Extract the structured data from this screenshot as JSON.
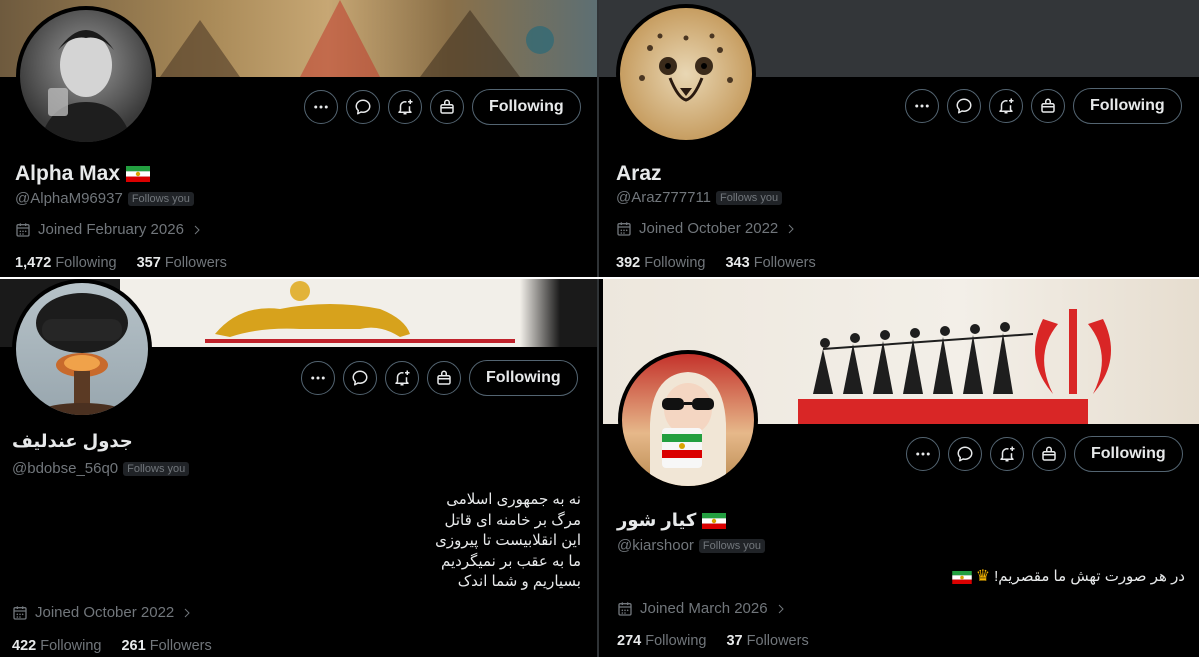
{
  "profiles": [
    {
      "name": "Alpha Max",
      "handle": "@AlphaM96937",
      "follows_you": "Follows you",
      "joined": "Joined February 2026",
      "following_count": "1,472",
      "following_label": "Following",
      "followers_count": "357",
      "followers_label": "Followers",
      "follow_button": "Following"
    },
    {
      "name": "Araz",
      "handle": "@Araz777711",
      "follows_you": "Follows you",
      "joined": "Joined October 2022",
      "following_count": "392",
      "following_label": "Following",
      "followers_count": "343",
      "followers_label": "Followers",
      "follow_button": "Following"
    },
    {
      "name": "جدول عندلیف",
      "handle": "@bdobse_56q0",
      "follows_you": "Follows you",
      "bio": "نه به جمهوری اسلامی\nمرگ بر خامنه ای قاتل\nاین انقلابیست تا پیروزی\nما به عقب بر نمیگردیم\nبسیاریم و شما اندک",
      "joined": "Joined October 2022",
      "following_count": "422",
      "following_label": "Following",
      "followers_count": "261",
      "followers_label": "Followers",
      "follow_button": "Following"
    },
    {
      "name": "کیار شور",
      "handle": "@kiarshoor",
      "follows_you": "Follows you",
      "bio": "در هر صورت تهش ما مقصریم!",
      "joined": "Joined March 2026",
      "following_count": "274",
      "following_label": "Following",
      "followers_count": "37",
      "followers_label": "Followers",
      "follow_button": "Following"
    }
  ],
  "icons": [
    "more-icon",
    "message-icon",
    "notification-add-icon",
    "subscribe-gift-icon",
    "calendar-icon",
    "chevron-right-icon",
    "iran-lion-sun-flag-icon",
    "crown-icon"
  ],
  "colors": {
    "background": "#000000",
    "text": "#e7e9ea",
    "muted": "#71767b",
    "border": "#536471"
  }
}
